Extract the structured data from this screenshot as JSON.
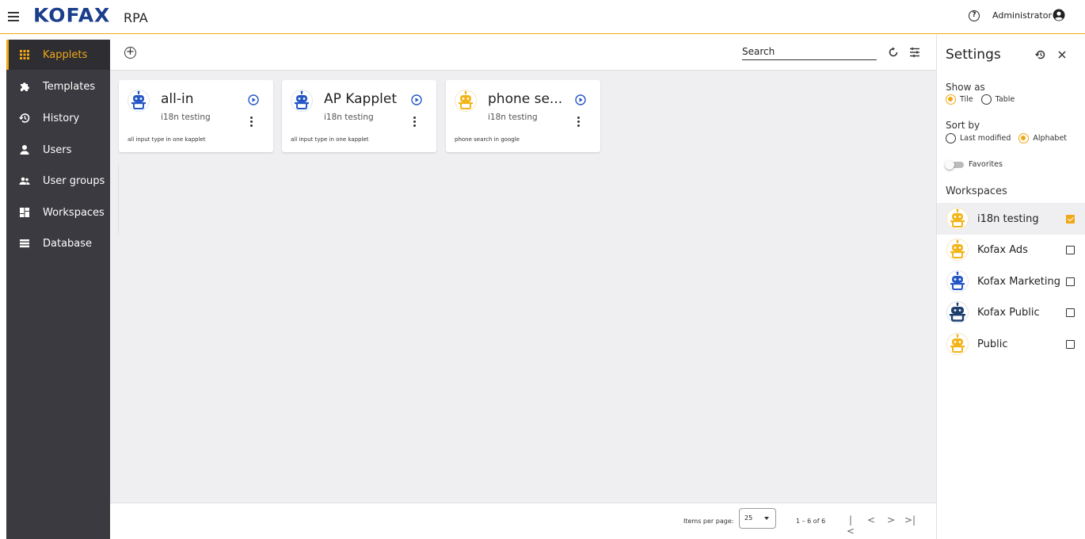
{
  "app": {
    "logo": "KOFAX",
    "product": "RPA"
  },
  "header": {
    "user_name": "Administrator"
  },
  "sidebar": {
    "items": [
      {
        "label": "Kapplets",
        "icon": "grid-icon",
        "active": true
      },
      {
        "label": "Templates",
        "icon": "puzzle-icon",
        "active": false
      },
      {
        "label": "History",
        "icon": "history-icon",
        "active": false
      },
      {
        "label": "Users",
        "icon": "user-icon",
        "active": false
      },
      {
        "label": "User groups",
        "icon": "users-icon",
        "active": false
      },
      {
        "label": "Workspaces",
        "icon": "dashboard-icon",
        "active": false
      },
      {
        "label": "Database",
        "icon": "list-icon",
        "active": false
      }
    ]
  },
  "toolbar": {
    "search_placeholder": "Search"
  },
  "cards": [
    {
      "title": "all-in",
      "workspace": "i18n testing",
      "description": "all input type in one kapplet",
      "bot_color": "blue"
    },
    {
      "title": "AP Kapplet",
      "workspace": "i18n testing",
      "description": "all input type in one kapplet",
      "bot_color": "blue"
    },
    {
      "title": "phone se...",
      "workspace": "i18n testing",
      "description": "phone search in google",
      "bot_color": "yellow"
    }
  ],
  "pager": {
    "items_per_page_label": "Items per page:",
    "items_per_page": "25",
    "range": "1 – 6 of 6"
  },
  "settings": {
    "title": "Settings",
    "show_as_label": "Show as",
    "show_as_options": [
      "Tile",
      "Table"
    ],
    "show_as_selected": "Tile",
    "sort_by_label": "Sort by",
    "sort_by_options": [
      "Last modified",
      "Alphabet"
    ],
    "sort_by_selected": "Alphabet",
    "favorites_label": "Favorites",
    "workspaces_label": "Workspaces",
    "workspaces": [
      {
        "name": "i18n testing",
        "checked": true,
        "bot_color": "yellow"
      },
      {
        "name": "Kofax Ads",
        "checked": false,
        "bot_color": "yellow"
      },
      {
        "name": "Kofax Marketing",
        "checked": false,
        "bot_color": "blue"
      },
      {
        "name": "Kofax Public",
        "checked": false,
        "bot_color": "navy"
      },
      {
        "name": "Public",
        "checked": false,
        "bot_color": "yellow"
      }
    ]
  },
  "colors": {
    "accent": "#f0a818",
    "sidebar": "#3a3a40",
    "logo": "#1a3e8c",
    "bot_blue": "#2457c5",
    "bot_yellow": "#f2b418",
    "bot_navy": "#1d3f6e"
  }
}
